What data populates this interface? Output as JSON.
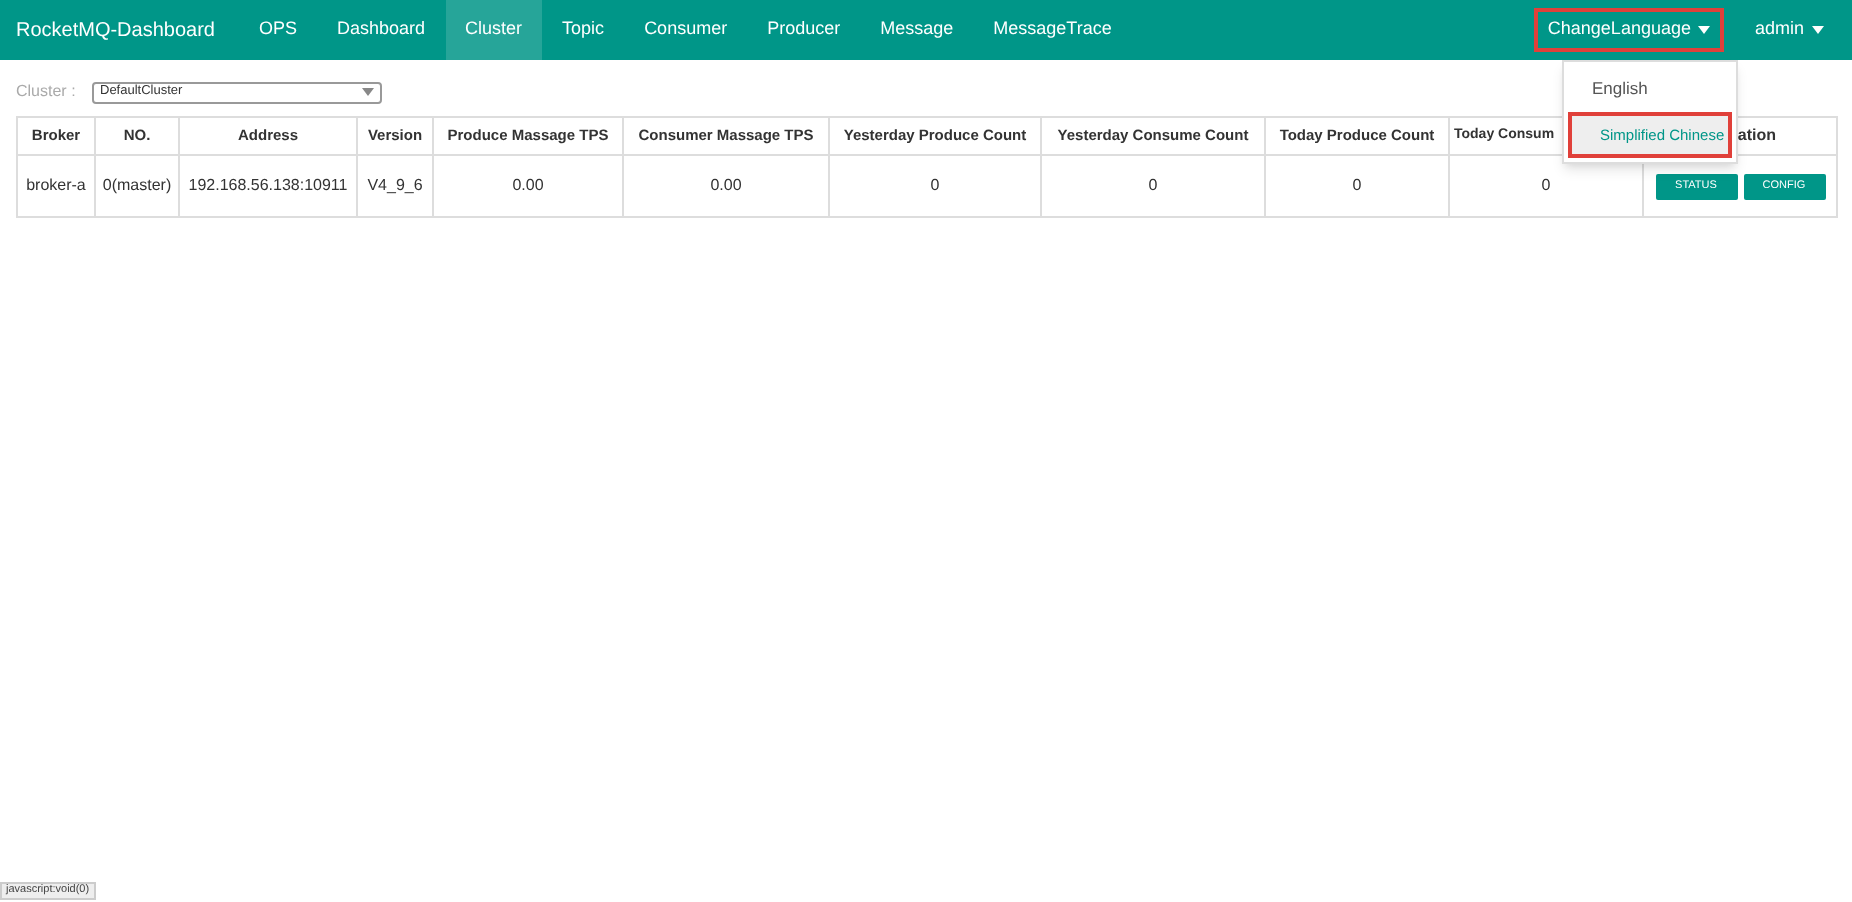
{
  "navbar": {
    "brand": "RocketMQ-Dashboard",
    "items": [
      {
        "label": "OPS",
        "selected": false
      },
      {
        "label": "Dashboard",
        "selected": false
      },
      {
        "label": "Cluster",
        "selected": true
      },
      {
        "label": "Topic",
        "selected": false
      },
      {
        "label": "Consumer",
        "selected": false
      },
      {
        "label": "Producer",
        "selected": false
      },
      {
        "label": "Message",
        "selected": false
      },
      {
        "label": "MessageTrace",
        "selected": false
      }
    ],
    "language_menu": {
      "label": "ChangeLanguage",
      "expanded": true,
      "options": [
        {
          "label": "English",
          "selected": false
        },
        {
          "label": "Simplified Chinese",
          "selected": true
        }
      ]
    },
    "user_menu": {
      "label": "admin"
    }
  },
  "filter": {
    "label": "Cluster :",
    "value": "DefaultCluster"
  },
  "table": {
    "columns": [
      "Broker",
      "NO.",
      "Address",
      "Version",
      "Produce Massage TPS",
      "Consumer Massage TPS",
      "Yesterday Produce Count",
      "Yesterday Consume Count",
      "Today Produce Count",
      "Today Consum",
      "ation"
    ],
    "rows": [
      {
        "cells": [
          "broker-a",
          "0(master)",
          "192.168.56.138:10911",
          "V4_9_6",
          "0.00",
          "0.00",
          "0",
          "0",
          "0",
          "0"
        ],
        "buttons": [
          "STATUS",
          "CONFIG"
        ]
      }
    ]
  },
  "status_bar": {
    "text": "javascript:void(0)"
  }
}
